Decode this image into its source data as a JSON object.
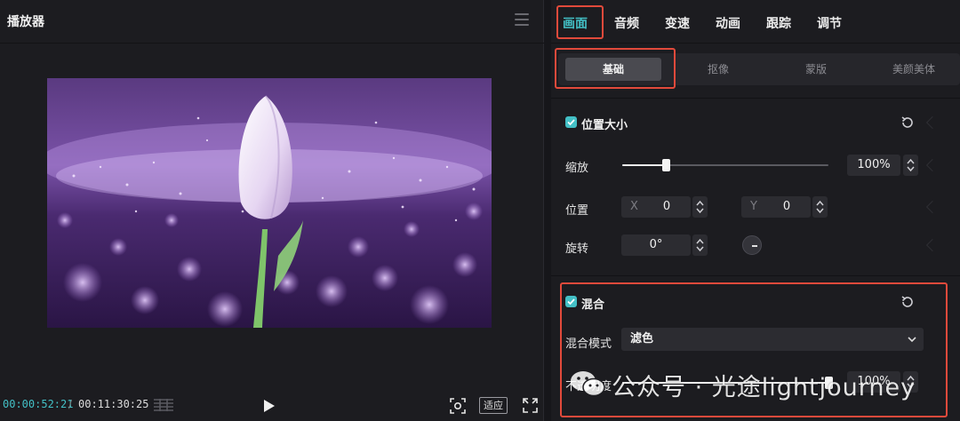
{
  "player": {
    "title": "播放器",
    "current_time": "00:00:52:21",
    "time_separator": "/",
    "total_time": "00:11:30:25",
    "fit_label": "适应"
  },
  "inspector": {
    "tabs": [
      {
        "label": "画面",
        "active": true
      },
      {
        "label": "音频",
        "active": false
      },
      {
        "label": "变速",
        "active": false
      },
      {
        "label": "动画",
        "active": false
      },
      {
        "label": "跟踪",
        "active": false
      },
      {
        "label": "调节",
        "active": false
      }
    ],
    "subtabs": [
      {
        "label": "基础",
        "active": true
      },
      {
        "label": "抠像",
        "active": false
      },
      {
        "label": "蒙版",
        "active": false
      },
      {
        "label": "美颜美体",
        "active": false
      }
    ],
    "position_size": {
      "title": "位置大小",
      "enabled": true,
      "scale_label": "缩放",
      "scale_value": "100%",
      "scale_fraction": 0.21,
      "position_label": "位置",
      "x_axis": "X",
      "x_value": "0",
      "y_axis": "Y",
      "y_value": "0",
      "rotation_label": "旋转",
      "rotation_value": "0°"
    },
    "blend": {
      "title": "混合",
      "enabled": true,
      "mode_label": "混合模式",
      "mode_value": "滤色",
      "opacity_label": "不透明度",
      "opacity_value": "100%",
      "opacity_fraction": 1.0
    }
  },
  "watermark": {
    "text": "公众号 · 光途lightjourney"
  },
  "colors": {
    "accent": "#43c0c6",
    "highlight_box": "#e24a3b",
    "panel_bg": "#1c1c20"
  },
  "icons": [
    "menu-icon",
    "grid-icon",
    "play-icon",
    "fit-frame-icon",
    "fullscreen-icon",
    "check-icon",
    "reset-icon",
    "stepper-icon",
    "chevron-down-icon",
    "rotate-dial-icon",
    "wechat-icon"
  ]
}
